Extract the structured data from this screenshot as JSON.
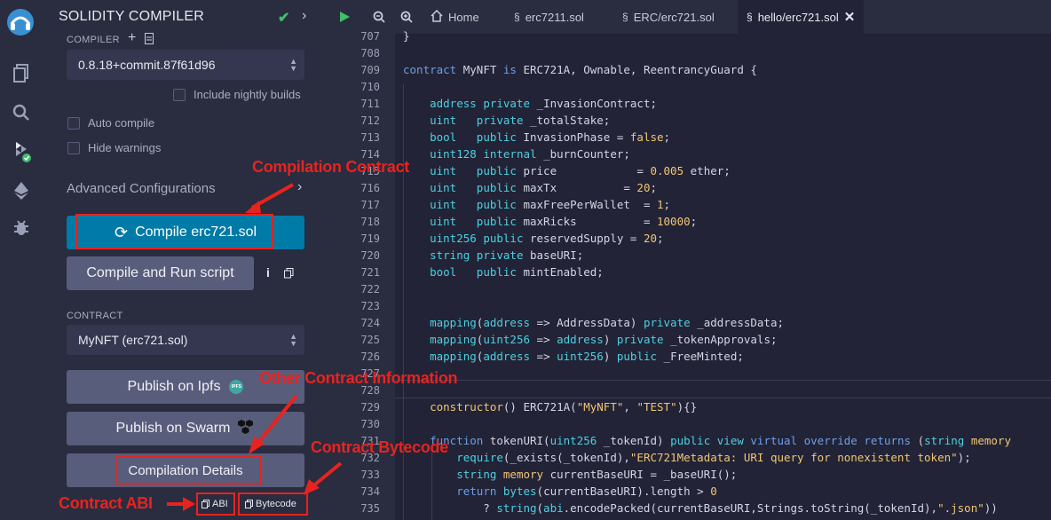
{
  "sidebar_icons": [
    "remix-logo-icon",
    "file-explorer-icon",
    "search-icon",
    "solidity-compiler-icon",
    "deploy-run-icon",
    "debugger-icon"
  ],
  "panel": {
    "title": "SOLIDITY COMPILER",
    "compiler_label": "COMPILER",
    "compiler_version": "0.8.18+commit.87f61d96",
    "include_nightly": "Include nightly builds",
    "auto_compile": "Auto compile",
    "hide_warnings": "Hide warnings",
    "advanced": "Advanced Configurations",
    "compile_button": "Compile erc721.sol",
    "compile_run_button": "Compile and Run script",
    "contract_label": "CONTRACT",
    "contract_selected": "MyNFT (erc721.sol)",
    "publish_ipfs": "Publish on Ipfs",
    "ipfs_badge": "IPFS",
    "publish_swarm": "Publish on Swarm",
    "compilation_details": "Compilation Details",
    "abi": "ABI",
    "bytecode": "Bytecode"
  },
  "annotations": {
    "compilation_contract": "Compilation Contract",
    "other_info": "Other Contract Information",
    "contract_bytecode": "Contract Bytecode",
    "contract_abi": "Contract ABI"
  },
  "tabs": [
    {
      "label": "Home"
    },
    {
      "label": "erc7211.sol"
    },
    {
      "label": "ERC/erc721.sol"
    },
    {
      "label": "hello/erc721.sol"
    }
  ],
  "code": [
    {
      "n": "707",
      "t": "}"
    },
    {
      "n": "708",
      "t": ""
    },
    {
      "n": "709",
      "t": "contract MyNFT is ERC721A, Ownable, ReentrancyGuard {"
    },
    {
      "n": "710",
      "t": ""
    },
    {
      "n": "711",
      "t": "    address private _InvasionContract;"
    },
    {
      "n": "712",
      "t": "    uint   private _totalStake;"
    },
    {
      "n": "713",
      "t": "    bool   public InvasionPhase = false;"
    },
    {
      "n": "714",
      "t": "    uint128 internal _burnCounter;"
    },
    {
      "n": "715",
      "t": "    uint   public price            = 0.005 ether;"
    },
    {
      "n": "716",
      "t": "    uint   public maxTx          = 20;"
    },
    {
      "n": "717",
      "t": "    uint   public maxFreePerWallet  = 1;"
    },
    {
      "n": "718",
      "t": "    uint   public maxRicks          = 10000;"
    },
    {
      "n": "719",
      "t": "    uint256 public reservedSupply = 20;"
    },
    {
      "n": "720",
      "t": "    string private baseURI;"
    },
    {
      "n": "721",
      "t": "    bool   public mintEnabled;"
    },
    {
      "n": "722",
      "t": ""
    },
    {
      "n": "723",
      "t": ""
    },
    {
      "n": "724",
      "t": "    mapping(address => AddressData) private _addressData;"
    },
    {
      "n": "725",
      "t": "    mapping(uint256 => address) private _tokenApprovals;"
    },
    {
      "n": "726",
      "t": "    mapping(address => uint256) public _FreeMinted;"
    },
    {
      "n": "727",
      "t": ""
    },
    {
      "n": "728",
      "t": ""
    },
    {
      "n": "729",
      "t": "    constructor() ERC721A(\"MyNFT\", \"TEST\"){}"
    },
    {
      "n": "730",
      "t": ""
    },
    {
      "n": "731",
      "t": "    function tokenURI(uint256 _tokenId) public view virtual override returns (string memory"
    },
    {
      "n": "732",
      "t": "        require(_exists(_tokenId),\"ERC721Metadata: URI query for nonexistent token\");"
    },
    {
      "n": "733",
      "t": "        string memory currentBaseURI = _baseURI();"
    },
    {
      "n": "734",
      "t": "        return bytes(currentBaseURI).length > 0"
    },
    {
      "n": "735",
      "t": "            ? string(abi.encodePacked(currentBaseURI,Strings.toString(_tokenId),\".json\"))"
    }
  ]
}
